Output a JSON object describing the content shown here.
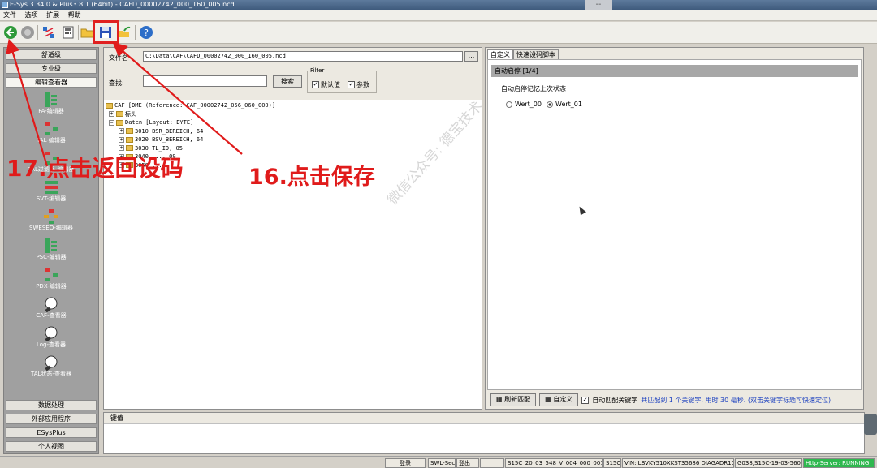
{
  "window": {
    "title": "E-Sys 3.34.0 & Plus3.8.1  (64bit) - CAFD_00002742_000_160_005.ncd",
    "drag_handle": "☷"
  },
  "menu": [
    "文件",
    "选项",
    "扩展",
    "帮助"
  ],
  "toolbar": {
    "icons": [
      "back-icon",
      "disconnect-icon",
      "network-icon",
      "calculate-icon",
      "open-folder-icon",
      "save-icon",
      "export-icon",
      "help-icon"
    ],
    "highlight_color": "#e02020"
  },
  "sidebar": {
    "top_buttons": [
      "舒适级",
      "专业级",
      "编辑查看器"
    ],
    "editors": [
      "FA-编辑器",
      "TAL-编辑器",
      "TAL过滤器-编辑器",
      "SVT-编辑器",
      "SWESEQ-编辑器",
      "PSC-编辑器",
      "PDX-编辑器",
      "CAF-查看器",
      "Log-查看器",
      "TAL状态-查看器"
    ],
    "bottom_buttons": [
      "数据处理",
      "外部应用程序",
      "ESysPlus",
      "个人视图"
    ]
  },
  "center": {
    "file_label": "文件名",
    "file_path": "C:\\Data\\CAF\\CAFD_00002742_000_160_005.ncd",
    "browse_label": "...",
    "search_label": "查找:",
    "search_value": "",
    "search_button": "搜索",
    "filter": {
      "title": "Filter",
      "default_label": "默认值",
      "param_label": "参数",
      "default_checked": true,
      "param_checked": true
    },
    "tree": [
      {
        "text": "CAF [DME (Reference: CAF_00002742_056_060_000)]",
        "level": 0,
        "expander": ""
      },
      {
        "text": "标头",
        "level": 1,
        "expander": "+"
      },
      {
        "text": "Daten [Layout: BYTE]",
        "level": 1,
        "expander": "−"
      },
      {
        "text": "3010 BSR_BEREICH, 64",
        "level": 2,
        "expander": "+"
      },
      {
        "text": "3020 BSV_BEREICH, 64",
        "level": 2,
        "expander": "+"
      },
      {
        "text": "3030 TL_ID, 05",
        "level": 2,
        "expander": "+"
      },
      {
        "text": "3040 ..., 09",
        "level": 2,
        "expander": "+"
      },
      {
        "text": "3050 ...",
        "level": 2,
        "expander": "+"
      }
    ]
  },
  "right": {
    "tabs": [
      "自定义",
      "快速设码脚本"
    ],
    "section_header": "自动启停 [1/4]",
    "sub_label": "自动启停记忆上次状态",
    "options": [
      {
        "label": "Wert_00",
        "checked": false
      },
      {
        "label": "Wert_01",
        "checked": true
      }
    ],
    "status": {
      "refresh_button": "刷新匹配",
      "custom_button": "自定义",
      "auto_match_label": "自动匹配关键字",
      "auto_match_checked": true,
      "match_info": "共匹配到 1 个关键字, 用时 30 毫秒. (双击关键字标题可快速定位)"
    }
  },
  "bottom": {
    "header": "键值"
  },
  "statusbar": [
    {
      "text": "登录",
      "kind": "button"
    },
    {
      "text": "SWL-Sec",
      "kind": "cell"
    },
    {
      "text": "登出",
      "kind": "cell"
    },
    {
      "text": "",
      "kind": "cell"
    },
    {
      "text": "S15C_20_03_548_V_004_000_001",
      "kind": "cell"
    },
    {
      "text": "S15C",
      "kind": "cell"
    },
    {
      "text": "VIN: LBVKY510XKST35686 DIAGADR10",
      "kind": "cell"
    },
    {
      "text": "G038,S15C-19-03-560",
      "kind": "cell"
    },
    {
      "text": "Http-Server: RUNNING",
      "kind": "http"
    }
  ],
  "annotations": {
    "step17": "17.点击返回设码",
    "step16": "16.点击保存",
    "color": "#e01b1b"
  },
  "watermark": "微信公众号: 德宝技术"
}
